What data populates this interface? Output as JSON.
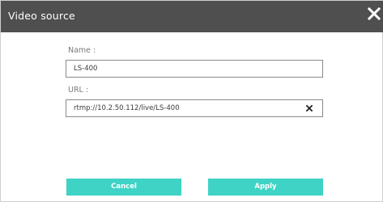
{
  "dialog": {
    "title": "Video source",
    "close_icon": "close-icon"
  },
  "form": {
    "name_label": "Name :",
    "name_value": "LS-400",
    "url_label": "URL :",
    "url_value": "rtmp://10.2.50.112/live/LS-400",
    "clear_icon": "clear-icon"
  },
  "buttons": {
    "cancel": "Cancel",
    "apply": "Apply"
  },
  "colors": {
    "titlebar": "#4f4f4f",
    "accent": "#3ed3c5"
  }
}
